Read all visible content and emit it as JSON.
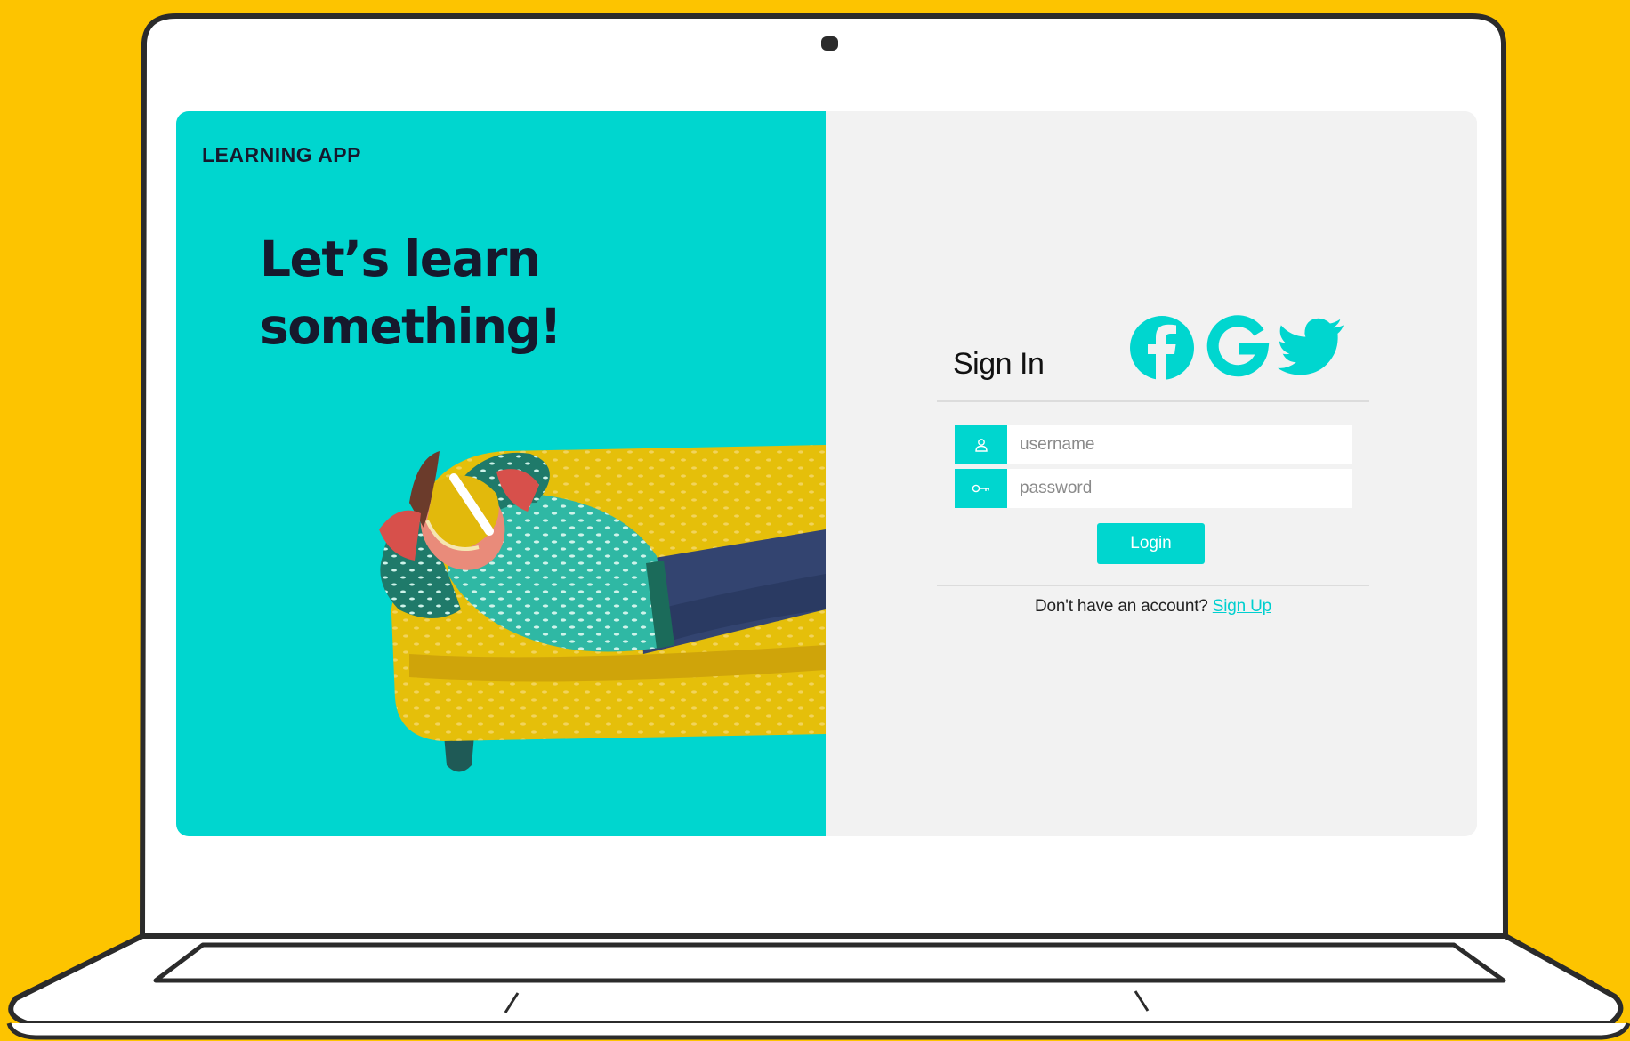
{
  "app": {
    "brand": "LEARNING APP",
    "headline": "Let’s learn something!"
  },
  "signin": {
    "title": "Sign In",
    "username_placeholder": "username",
    "password_placeholder": "password",
    "login_label": "Login",
    "no_account_text": "Don't have an account?",
    "signup_label": "Sign Up"
  },
  "social": {
    "icons": [
      "facebook-icon",
      "google-icon",
      "twitter-icon"
    ]
  },
  "icons": {
    "username_field": "user-icon",
    "password_field": "key-icon"
  },
  "colors": {
    "background": "#FDC400",
    "accent": "#00D6CF",
    "panel": "#f2f2f2",
    "headline": "#16192d"
  }
}
